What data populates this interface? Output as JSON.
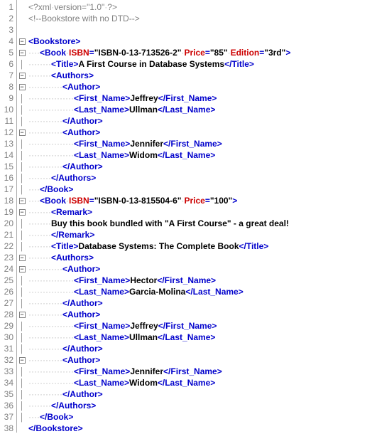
{
  "gutter": {
    "start": 1,
    "end": 38
  },
  "fold": [
    "",
    "",
    "",
    "box",
    "box",
    "guide",
    "box",
    "box",
    "guide",
    "guide",
    "guide",
    "box",
    "guide",
    "guide",
    "guide",
    "guide",
    "guide",
    "box",
    "box",
    "guide",
    "guide",
    "guide",
    "box",
    "box",
    "guide",
    "guide",
    "guide",
    "box",
    "guide",
    "guide",
    "guide",
    "box",
    "guide",
    "guide",
    "guide",
    "guide",
    "guide",
    ""
  ],
  "xml": {
    "decl_open": "<?",
    "decl_name": "xml",
    "decl_attr": "version",
    "decl_eq": "=",
    "decl_val": "\"1.0\"",
    "decl_close": "?>",
    "comment": "<!--Bookstore with no DTD-->"
  },
  "tags": {
    "bookstore_open": "<Bookstore>",
    "bookstore_close": "</Bookstore>",
    "book_open": "<Book",
    "book_close": "</Book>",
    "isbn": "ISBN",
    "price": "Price",
    "edition": "Edition",
    "title_open": "<Title>",
    "title_close": "</Title>",
    "authors_open": "<Authors>",
    "authors_close": "</Authors>",
    "author_open": "<Author>",
    "author_close": "</Author>",
    "fn_open": "<First_Name>",
    "fn_close": "</First_Name>",
    "ln_open": "<Last_Name>",
    "ln_close": "</Last_Name>",
    "remark_open": "<Remark>",
    "remark_close": "</Remark>",
    "gt": ">",
    "eq": "="
  },
  "values": {
    "isbn1": "\"ISBN-0-13-713526-2\"",
    "price1": "\"85\"",
    "edition1": "\"3rd\"",
    "title1": "A First Course in Database Systems",
    "fn1": "Jeffrey",
    "ln1": "Ullman",
    "fn2": "Jennifer",
    "ln2": "Widom",
    "isbn2": "\"ISBN-0-13-815504-6\"",
    "price2": "\"100\"",
    "remark": "Buy this book bundled with \"A First Course\" - a great deal!",
    "title2": "Database Systems: The Complete Book",
    "fn3": "Hector",
    "ln3": "Garcia-Molina",
    "fn4": "Jeffrey",
    "ln4": "Ullman",
    "fn5": "Jennifer",
    "ln5": "Widom"
  },
  "ws": {
    "d1": "·",
    "i1": "····",
    "i2": "········",
    "i3": "············",
    "i4": "················"
  }
}
